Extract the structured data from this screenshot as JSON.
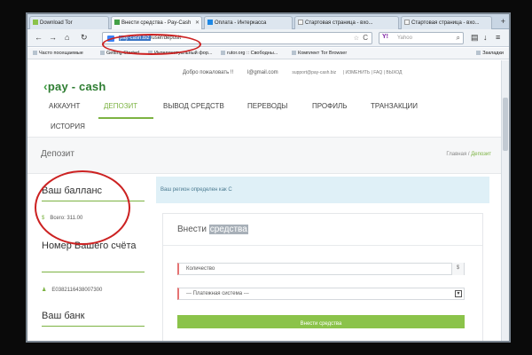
{
  "browser": {
    "tabs": [
      {
        "label": "Download Tor",
        "active": false
      },
      {
        "label": "Внести средства - Pay-Cash",
        "active": true
      },
      {
        "label": "Оплата - Интеркасса",
        "active": false
      },
      {
        "label": "Стартовая страница - вхо...",
        "active": false
      },
      {
        "label": "Стартовая страница - вхо...",
        "active": false
      }
    ],
    "new_tab": "+",
    "address": {
      "host": "pay-cash.biz",
      "path": "/user/deposit"
    },
    "search": {
      "engine": "Y!",
      "placeholder": "Yahoo"
    },
    "bookmarks": [
      "Часто посещаемые",
      "Getting Started",
      "Интеллектуальный фор...",
      "rutor.org :: Свободны...",
      "Комплект Tor Browser"
    ],
    "bookmarks_right": "Закладки",
    "nav": {
      "back": "←",
      "forward": "→",
      "home": "⌂",
      "reload": "↻",
      "star": "☆",
      "refresh": "C",
      "menu": "≡",
      "download": "↓"
    }
  },
  "site": {
    "top": {
      "welcome": "Добро пожаловать !!",
      "email": "l@gmail.com",
      "support": "support@pay-cash.biz",
      "links": "| ИЗМЕНИТЬ | FAQ | ВЫХОД"
    },
    "logo": "pay - cash",
    "menu": [
      "АККАУНТ",
      "ДЕПОЗИТ",
      "ВЫВОД СРЕДСТВ",
      "ПЕРЕВОДЫ",
      "ПРОФИЛЬ",
      "ТРАНЗАКЦИИ",
      "ИСТОРИЯ"
    ],
    "page_title": "Депозит",
    "breadcrumb": {
      "home": "Главная",
      "sep": "/",
      "current": "Депозит"
    },
    "sidebar": {
      "balance_title": "Ваш балланс",
      "balance_value": "Всего: 311.00",
      "account_title": "Номер Вашего счёта",
      "account_value": "E0382116438007300",
      "bank_title": "Ваш банк"
    },
    "alert": "Ваш регион определен как С",
    "form": {
      "title_a": "Внести ",
      "title_b": "средства",
      "amount_placeholder": "Количество",
      "amount_suffix": "$",
      "system_select": "--- Платежная система ---",
      "submit": "Внести средства"
    }
  },
  "colors": {
    "brand_green": "#7cb342",
    "annotation_red": "#c22222"
  }
}
